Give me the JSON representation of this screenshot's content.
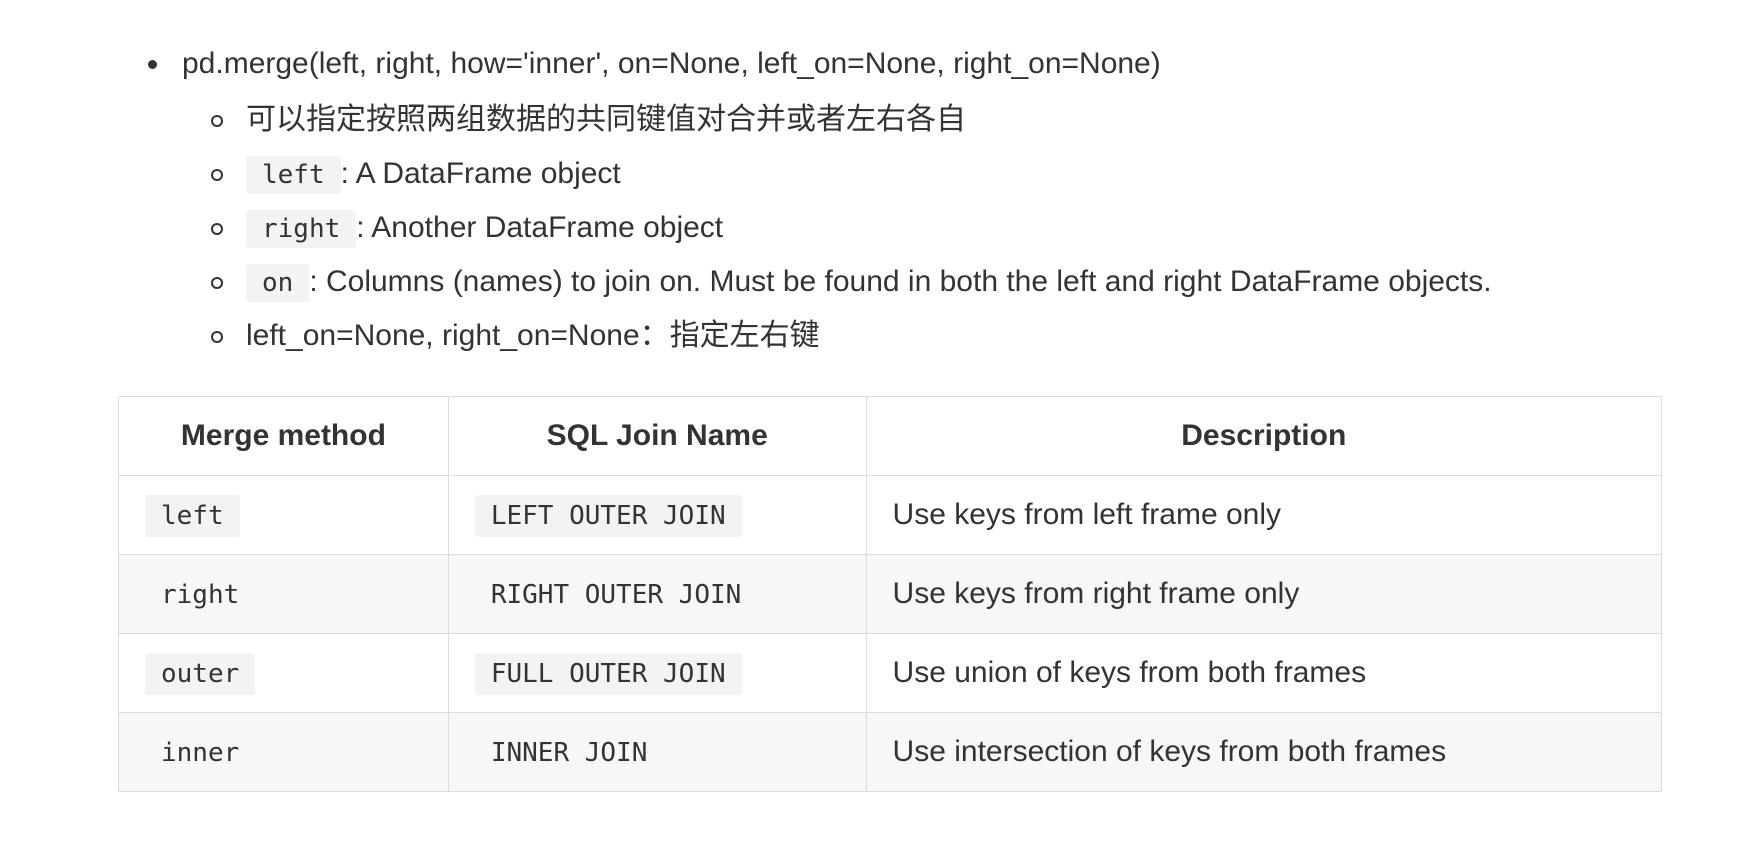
{
  "merge_signature": "pd.merge(left, right, how='inner', on=None, left_on=None, right_on=None)",
  "sub_items": [
    {
      "code": "",
      "text": "可以指定按照两组数据的共同键值对合并或者左右各自"
    },
    {
      "code": "left",
      "text": ": A DataFrame object"
    },
    {
      "code": "right",
      "text": ": Another DataFrame object"
    },
    {
      "code": "on",
      "text": ": Columns (names) to join on. Must be found in both the left and right DataFrame objects."
    },
    {
      "code": "",
      "text": "left_on=None, right_on=None：指定左右键"
    }
  ],
  "table": {
    "headers": [
      "Merge method",
      "SQL Join Name",
      "Description"
    ],
    "rows": [
      {
        "method": "left",
        "sql": "LEFT OUTER JOIN",
        "desc": "Use keys from left frame only"
      },
      {
        "method": "right",
        "sql": "RIGHT OUTER JOIN",
        "desc": "Use keys from right frame only"
      },
      {
        "method": "outer",
        "sql": "FULL OUTER JOIN",
        "desc": "Use union of keys from both frames"
      },
      {
        "method": "inner",
        "sql": "INNER JOIN",
        "desc": "Use intersection of keys from both frames"
      }
    ]
  }
}
